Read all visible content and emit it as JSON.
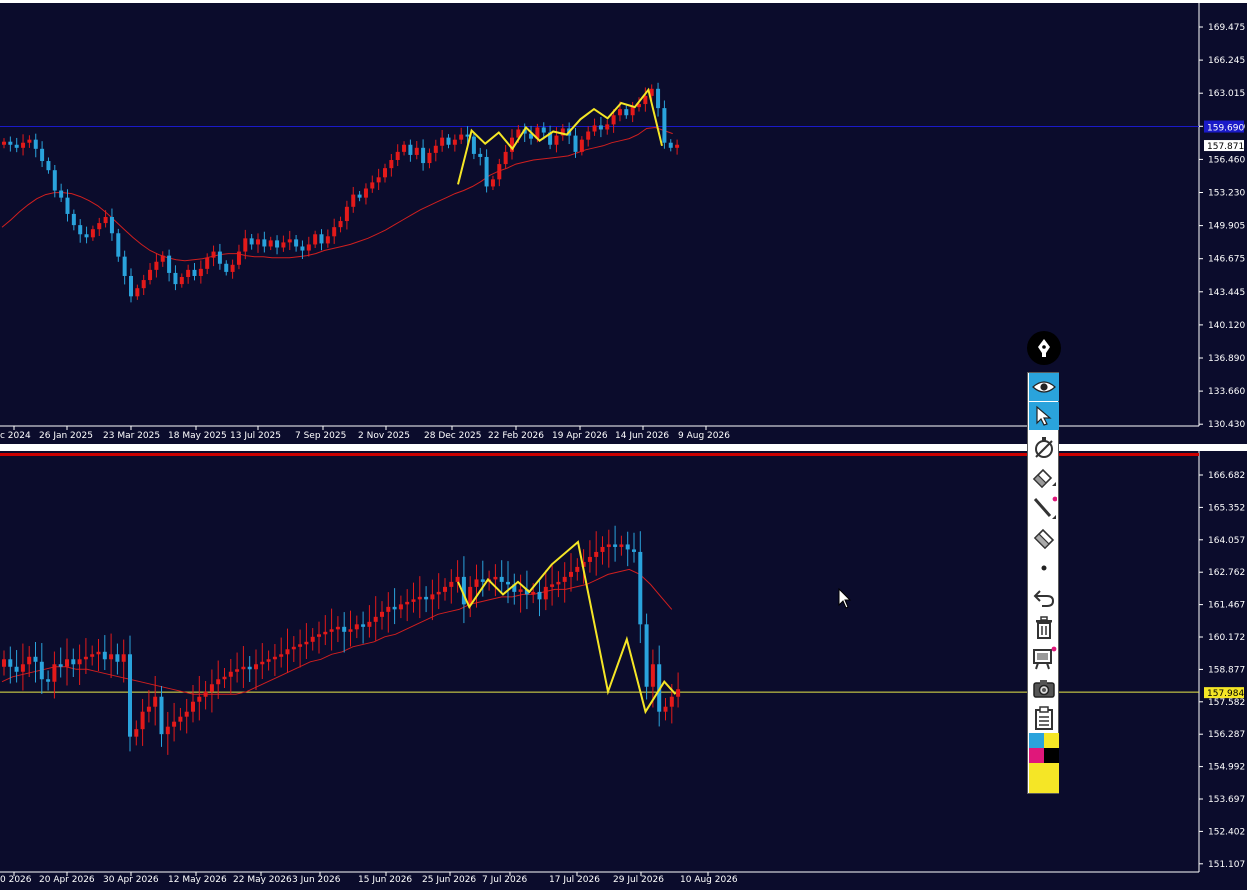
{
  "colors": {
    "background": "#0b0c2c",
    "bull": "#e31a1a",
    "bear": "#2aa3dc",
    "ma": "#d01f1f",
    "zigzag": "#f5e626",
    "axis_text": "#ffffff",
    "hline_pane1": "#1a1ac8",
    "hline_pane2": "#e8e84a",
    "price_label_bg": "#ffffff",
    "price_label_yellow": "#f5e626",
    "separator_red": "#cc0000"
  },
  "chart_data": [
    {
      "type": "candlestick",
      "title": "",
      "price_axis": {
        "ticks": [
          "169.475",
          "166.245",
          "163.015",
          "159.690",
          "156.460",
          "153.230",
          "149.905",
          "146.675",
          "143.445",
          "140.120",
          "136.890",
          "133.660",
          "130.430"
        ],
        "range": [
          130.43,
          169.475
        ],
        "current_price_label": "157.871",
        "horizontal_line_label": "159.690",
        "horizontal_line_price": 159.69
      },
      "time_axis": {
        "ticks": [
          "c 2024",
          "26 Jan 2025",
          "23 Mar 2025",
          "18 May 2025",
          "13 Jul 2025",
          "7 Sep 2025",
          "2 Nov 2025",
          "28 Dec 2025",
          "22 Feb 2026",
          "19 Apr 2026",
          "14 Jun 2026",
          "9 Aug 2026"
        ]
      },
      "close_series": [
        158.2,
        157.9,
        157.6,
        158.1,
        158.4,
        157.5,
        156.3,
        155.4,
        153.4,
        152.7,
        151.1,
        150.0,
        149.1,
        148.8,
        149.6,
        150.2,
        150.8,
        149.2,
        146.9,
        145.0,
        143.0,
        143.8,
        144.6,
        145.6,
        146.4,
        147.0,
        145.3,
        144.2,
        144.9,
        145.6,
        145.0,
        145.7,
        146.8,
        147.4,
        146.2,
        145.4,
        146.1,
        147.4,
        148.7,
        148.1,
        148.6,
        147.9,
        148.5,
        147.8,
        148.3,
        148.6,
        147.9,
        147.5,
        148.1,
        149.1,
        148.2,
        148.9,
        149.8,
        150.4,
        151.8,
        153.0,
        152.7,
        153.6,
        154.2,
        154.7,
        155.6,
        156.4,
        157.2,
        157.9,
        156.9,
        157.6,
        156.1,
        157.1,
        157.8,
        158.6,
        157.9,
        158.4,
        158.9,
        158.7,
        157.0,
        156.7,
        153.8,
        154.5,
        156.0,
        157.2,
        158.6,
        159.4,
        159.0,
        158.5,
        159.6,
        159.1,
        157.9,
        158.8,
        159.5,
        158.8,
        157.2,
        158.4,
        159.2,
        159.8,
        159.4,
        159.9,
        160.8,
        161.4,
        160.8,
        161.6,
        161.9,
        162.7,
        163.4,
        161.5,
        158.1,
        157.6,
        157.9
      ],
      "moving_average_series": [
        149.8,
        150.5,
        151.3,
        152.0,
        152.6,
        153.0,
        153.2,
        153.2,
        153.1,
        152.8,
        152.4,
        151.9,
        151.2,
        150.4,
        149.6,
        148.8,
        148.1,
        147.5,
        147.1,
        146.8,
        146.6,
        146.5,
        146.6,
        146.7,
        146.9,
        147.1,
        147.2,
        147.2,
        147.0,
        146.9,
        146.9,
        146.8,
        146.8,
        146.8,
        146.9,
        147.0,
        147.2,
        147.5,
        147.7,
        147.9,
        148.1,
        148.4,
        148.7,
        149.1,
        149.5,
        150.0,
        150.5,
        151.0,
        151.5,
        151.9,
        152.3,
        152.7,
        153.1,
        153.4,
        153.8,
        154.3,
        154.9,
        155.3,
        155.6,
        156.0,
        156.2,
        156.4,
        156.5,
        156.6,
        156.7,
        156.8,
        157.1,
        157.4,
        157.6,
        157.8,
        158.1,
        158.3,
        158.5,
        158.9,
        159.5,
        159.6,
        159.3,
        159.0
      ],
      "zigzag": [
        [
          0,
          154.0
        ],
        [
          2,
          159.3
        ],
        [
          4,
          158.0
        ],
        [
          6,
          159.1
        ],
        [
          8,
          157.5
        ],
        [
          10,
          159.6
        ],
        [
          12,
          158.3
        ],
        [
          14,
          159.2
        ],
        [
          16,
          158.9
        ],
        [
          18,
          160.4
        ],
        [
          20,
          161.4
        ],
        [
          22,
          160.5
        ],
        [
          24,
          162.0
        ],
        [
          26,
          161.6
        ],
        [
          28,
          163.3
        ],
        [
          30,
          157.8
        ]
      ]
    },
    {
      "type": "candlestick",
      "title": "",
      "price_axis": {
        "ticks": [
          "166.682",
          "165.352",
          "164.057",
          "162.762",
          "161.467",
          "160.172",
          "158.877",
          "157.582",
          "156.287",
          "154.992",
          "153.697",
          "152.402",
          "151.107"
        ],
        "range": [
          151.107,
          166.682
        ],
        "current_price_label": "157.984",
        "horizontal_line_price": 157.984
      },
      "time_axis": {
        "ticks": [
          "0 2026",
          "20 Apr 2026",
          "30 Apr 2026",
          "12 May 2026",
          "22 May 2026",
          "3 Jun 2026",
          "15 Jun 2026",
          "25 Jun 2026",
          "7 Jul 2026",
          "17 Jul 2026",
          "29 Jul 2026",
          "10 Aug 2026"
        ]
      },
      "close_series": [
        159.3,
        159.0,
        158.8,
        159.1,
        159.4,
        159.2,
        158.5,
        158.4,
        159.1,
        159.0,
        159.3,
        159.1,
        159.3,
        159.4,
        159.5,
        159.6,
        159.3,
        159.5,
        159.2,
        159.5,
        156.2,
        156.5,
        157.2,
        157.4,
        157.8,
        156.3,
        156.6,
        156.8,
        157.0,
        157.2,
        157.6,
        157.8,
        158.0,
        158.3,
        158.5,
        158.6,
        158.8,
        158.9,
        159.0,
        158.9,
        159.1,
        159.2,
        159.3,
        159.4,
        159.5,
        159.7,
        159.8,
        159.9,
        160.0,
        160.2,
        160.3,
        160.4,
        160.5,
        160.6,
        160.4,
        160.5,
        160.7,
        160.6,
        160.8,
        161.0,
        161.2,
        161.4,
        161.3,
        161.5,
        161.6,
        161.7,
        161.8,
        161.7,
        161.9,
        162.0,
        162.2,
        162.4,
        162.6,
        161.5,
        162.2,
        162.5,
        162.4,
        162.5,
        162.6,
        162.4,
        162.3,
        162.0,
        162.1,
        161.9,
        162.0,
        161.7,
        162.2,
        162.3,
        162.4,
        162.6,
        162.8,
        163.0,
        163.2,
        163.4,
        163.6,
        163.8,
        163.9,
        163.8,
        163.9,
        163.7,
        163.6,
        160.7,
        158.2,
        159.1,
        157.2,
        157.4,
        157.8,
        158.1
      ],
      "moving_average_series": [
        158.4,
        158.6,
        158.7,
        158.8,
        158.9,
        159.0,
        159.0,
        158.9,
        158.9,
        158.8,
        158.7,
        158.6,
        158.5,
        158.4,
        158.3,
        158.2,
        158.1,
        158.0,
        157.9,
        157.9,
        157.9,
        157.9,
        157.9,
        158.0,
        158.2,
        158.4,
        158.6,
        158.8,
        159.0,
        159.2,
        159.3,
        159.5,
        159.6,
        159.8,
        159.9,
        160.0,
        160.2,
        160.3,
        160.5,
        160.7,
        160.9,
        161.1,
        161.2,
        161.3,
        161.5,
        161.6,
        161.7,
        161.8,
        161.8,
        161.9,
        161.9,
        162.0,
        162.1,
        162.1,
        162.2,
        162.3,
        162.5,
        162.7,
        162.8,
        162.9,
        162.7,
        162.3,
        161.8,
        161.3
      ],
      "zigzag": [
        [
          0,
          162.4
        ],
        [
          3,
          161.4
        ],
        [
          8,
          162.5
        ],
        [
          12,
          161.9
        ],
        [
          16,
          162.4
        ],
        [
          19,
          162.0
        ],
        [
          25,
          163.1
        ],
        [
          32,
          164.0
        ],
        [
          40,
          158.0
        ],
        [
          45,
          160.1
        ],
        [
          50,
          157.2
        ],
        [
          55,
          158.4
        ],
        [
          58,
          157.9
        ]
      ]
    }
  ],
  "toolbar": {
    "pen_icon": "fountain-pen-icon",
    "buttons": [
      "eye-icon",
      "arrow-cursor-icon",
      "compass-icon",
      "eraser-icon",
      "line-icon",
      "eraser-big-icon",
      "dot-icon",
      "undo-icon",
      "trash-icon",
      "monitor-icon",
      "camera-icon",
      "clipboard-icon"
    ],
    "swatches": [
      "#2aa3dc",
      "#f5e626",
      "#e0177a",
      "#000000",
      "#f5e626"
    ]
  }
}
